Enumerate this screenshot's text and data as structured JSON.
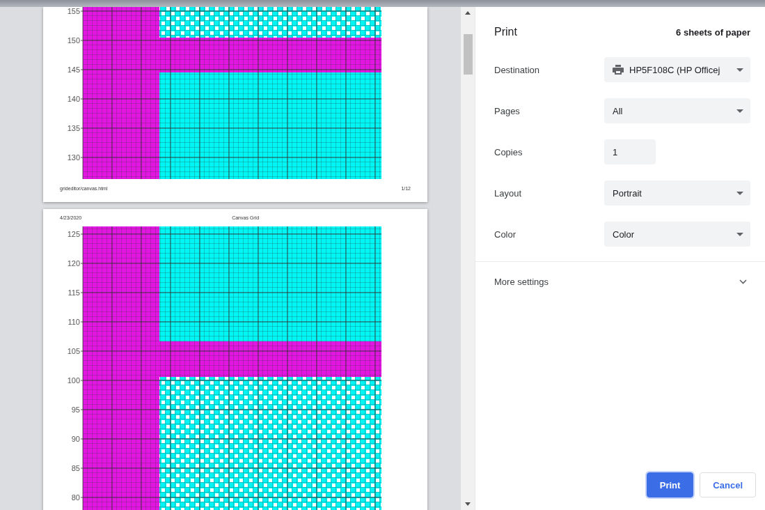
{
  "preview": {
    "pages": [
      {
        "y_ticks": [
          "155",
          "150",
          "145",
          "140",
          "135",
          "130"
        ],
        "footer": {
          "left": "grideditor/canvas.html",
          "right": "1/12"
        }
      },
      {
        "header": {
          "left": "4/23/2020",
          "center": "Canvas Grid"
        },
        "y_ticks": [
          "125",
          "120",
          "115",
          "110",
          "105",
          "100",
          "95",
          "90",
          "85",
          "80"
        ]
      }
    ]
  },
  "panel": {
    "title": "Print",
    "sheet_count": "6 sheets of paper",
    "settings": [
      {
        "kind": "printer",
        "label": "Destination",
        "value": "HP5F108C (HP Officej"
      },
      {
        "kind": "select",
        "label": "Pages",
        "value": "All"
      },
      {
        "kind": "number",
        "label": "Copies",
        "value": "1"
      },
      {
        "kind": "select",
        "label": "Layout",
        "value": "Portrait"
      },
      {
        "kind": "select",
        "label": "Color",
        "value": "Color"
      }
    ],
    "more_settings": {
      "label": "More settings",
      "expanded": false
    },
    "buttons": [
      {
        "label": "Print",
        "primary": true
      },
      {
        "label": "Cancel",
        "primary": false
      }
    ]
  }
}
